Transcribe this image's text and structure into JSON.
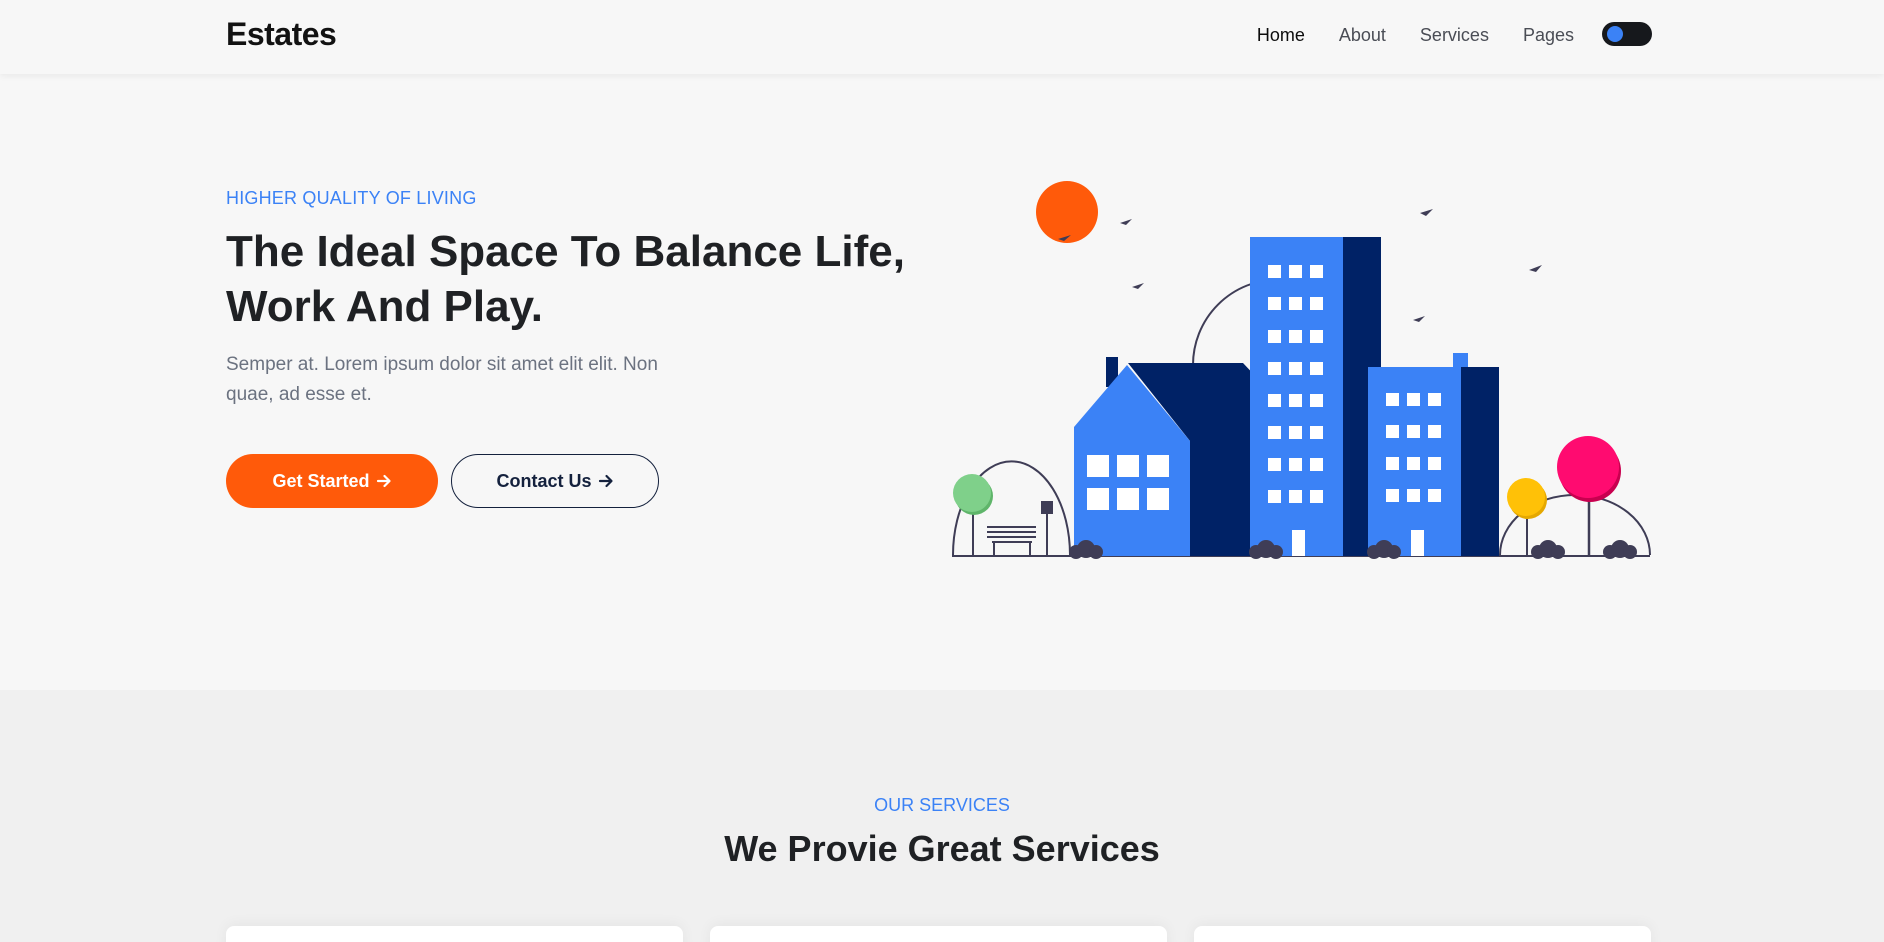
{
  "header": {
    "logo": "Estates",
    "nav": [
      "Home",
      "About",
      "Services",
      "Pages"
    ],
    "active_nav": "Home"
  },
  "hero": {
    "eyebrow": "HIGHER QUALITY OF LIVING",
    "title_line1": "The Ideal Space To Balance Life,",
    "title_line2": "Work And Play.",
    "text": "Semper at. Lorem ipsum dolor sit amet elit elit. Non quae, ad esse et.",
    "primary_button": "Get Started",
    "secondary_button": "Contact Us",
    "button_icon": "arrow-right-icon"
  },
  "services": {
    "eyebrow": "OUR SERVICES",
    "title": "We Provie Great Services"
  },
  "colors": {
    "accent_blue": "#3b82f6",
    "accent_orange": "#ff5a0a",
    "navy": "#14213d",
    "dark_blue": "#002266"
  },
  "icons": {
    "theme_toggle": "dark-mode-toggle",
    "hero_illustration": "city-buildings-illustration"
  }
}
